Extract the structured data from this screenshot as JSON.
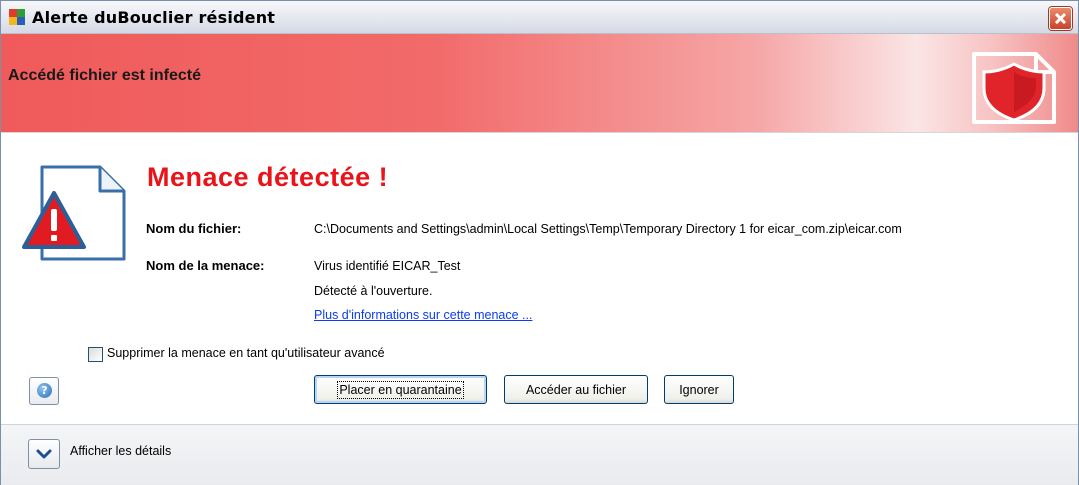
{
  "window": {
    "title": "Alerte duBouclier résident",
    "app_icon": "avg-logo-icon",
    "close_icon": "close-icon"
  },
  "banner": {
    "text": "Accédé fichier est infecté",
    "icon": "shield-icon"
  },
  "alert": {
    "icon": "warning-document-icon",
    "title": "Menace détectée !",
    "file_label": "Nom du fichier:",
    "file_value": "C:\\Documents and Settings\\admin\\Local Settings\\Temp\\Temporary Directory 1 for eicar_com.zip\\eicar.com",
    "threat_label": "Nom de la menace:",
    "threat_value": "Virus identifié EICAR_Test",
    "detected_on": "Détecté à l'ouverture.",
    "more_info_link": "Plus d'informations sur cette menace ..."
  },
  "options": {
    "advanced_remove_label": "Supprimer la menace en tant qu'utilisateur avancé",
    "advanced_remove_checked": false
  },
  "buttons": {
    "help_icon": "help-icon",
    "quarantine_label": "Placer en quarantaine",
    "access_file_label": "Accéder au fichier",
    "ignore_label": "Ignorer"
  },
  "footer": {
    "details_label": "Afficher les détails",
    "details_icon": "chevron-down-icon"
  },
  "colors": {
    "threat_title": "#e8141a",
    "link": "#0a3df0",
    "banner_red": "#f05a5a"
  }
}
